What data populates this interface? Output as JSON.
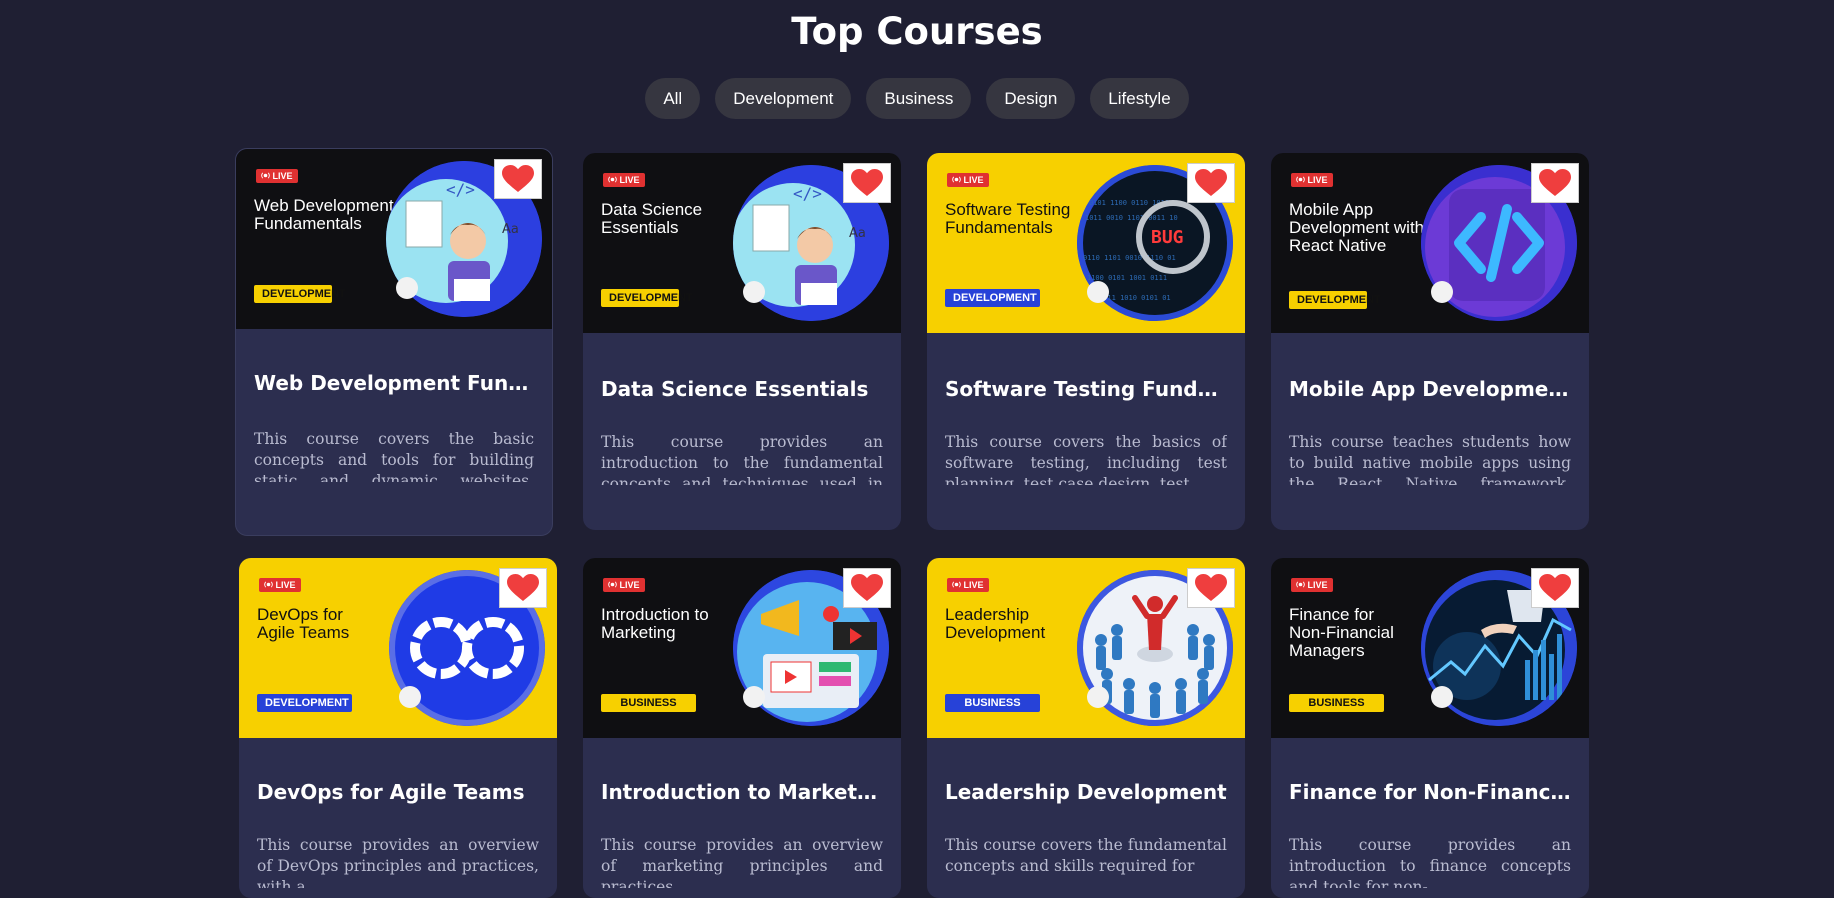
{
  "page": {
    "title": "Top Courses"
  },
  "filters": [
    "All",
    "Development",
    "Business",
    "Design",
    "Lifestyle"
  ],
  "colors": {
    "background": "#1f1f33",
    "card": "#2c2e4f",
    "yellow": "#f7d000",
    "blue": "#2742d8",
    "live_red": "#e03131",
    "heart_red": "#ef3e3e"
  },
  "courses": [
    {
      "live": "LIVE",
      "banner_title": "Web Development Fundamentals",
      "category": "DEVELOPMENT",
      "title": "Web Development Fundam...",
      "description": "This course covers the basic concepts and tools for building static and dynamic websites. Students will learn",
      "icon": "developer-illustration"
    },
    {
      "live": "LIVE",
      "banner_title": "Data Science Essentials",
      "category": "DEVELOPMENT",
      "title": "Data Science Essentials",
      "description": "This course provides an introduction to the fundamental concepts and techniques used in data science.",
      "icon": "developer-illustration"
    },
    {
      "live": "LIVE",
      "banner_title": "Software Testing Fundamentals",
      "category": "DEVELOPMENT",
      "title": "Software Testing Fundamen...",
      "description": "This course covers the basics of software testing, including test planning, test case design, test",
      "icon": "bug-magnifier"
    },
    {
      "live": "LIVE",
      "banner_title": "Mobile App Development with React Native",
      "category": "DEVELOPMENT",
      "title": "Mobile App Development w...",
      "description": "This course teaches students how to build native mobile apps using the React Native framework. Students will",
      "icon": "code-tag"
    },
    {
      "live": "LIVE",
      "banner_title": "DevOps for Agile Teams",
      "category": "DEVELOPMENT",
      "title": "DevOps for Agile Teams",
      "description": "This course provides an overview of DevOps principles and practices, with a",
      "icon": "infinity-loop"
    },
    {
      "live": "LIVE",
      "banner_title": "Introduction to Marketing",
      "category": "BUSINESS",
      "title": "Introduction to Marketing",
      "description": "This course provides an overview of marketing principles and practices,",
      "icon": "megaphone-screen"
    },
    {
      "live": "LIVE",
      "banner_title": "Leadership Development",
      "category": "BUSINESS",
      "title": "Leadership Development",
      "description": "This course covers the fundamental concepts and skills required for",
      "icon": "leader-crowd"
    },
    {
      "live": "LIVE",
      "banner_title": "Finance for Non-Financial Managers",
      "category": "BUSINESS",
      "title": "Finance for Non-Financial ...",
      "description": "This course provides an introduction to finance concepts and tools for non-",
      "icon": "finance-chart"
    }
  ]
}
